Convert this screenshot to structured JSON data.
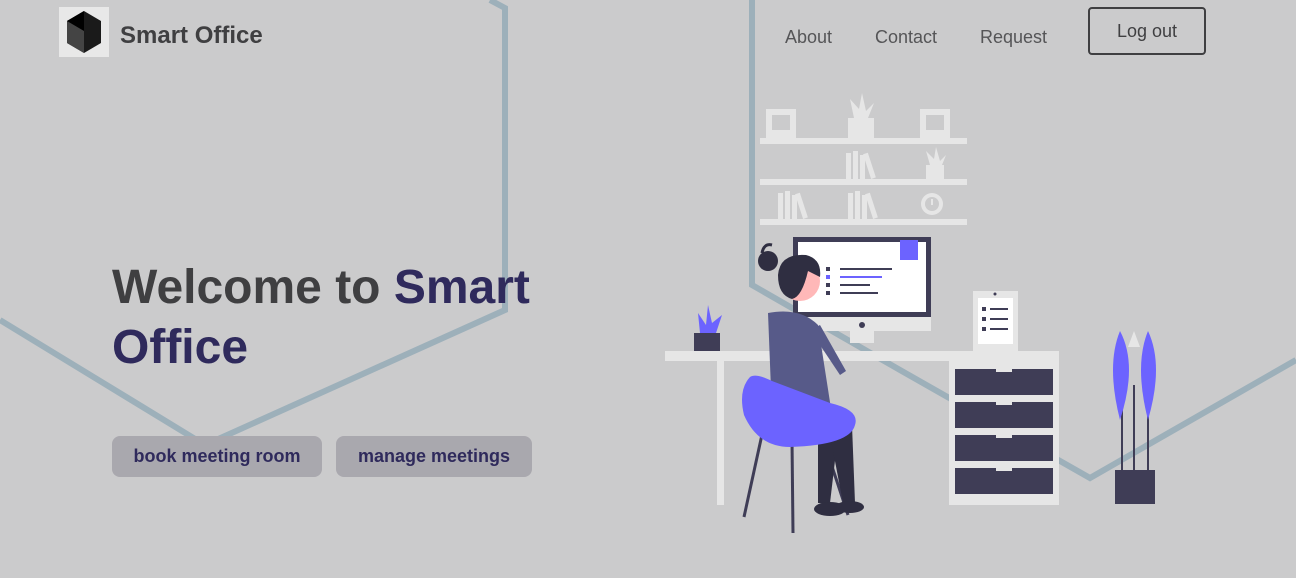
{
  "header": {
    "brand": "Smart Office",
    "nav": [
      {
        "label": "About"
      },
      {
        "label": "Contact"
      },
      {
        "label": "Request"
      }
    ],
    "logout_label": "Log out"
  },
  "hero": {
    "title_part1": "Welcome to ",
    "title_part2": "Smart Office"
  },
  "actions": {
    "book_label": "book meeting room",
    "manage_label": "manage meetings"
  },
  "colors": {
    "background": "#cbcbcc",
    "accent": "#6c63ff",
    "dark_purple": "#2f2a5c",
    "text_dark": "#3f3f41",
    "button_bg": "#a9a8ae",
    "line": "#9db0ba"
  },
  "icons": {
    "logo": "hexagon-logo"
  }
}
